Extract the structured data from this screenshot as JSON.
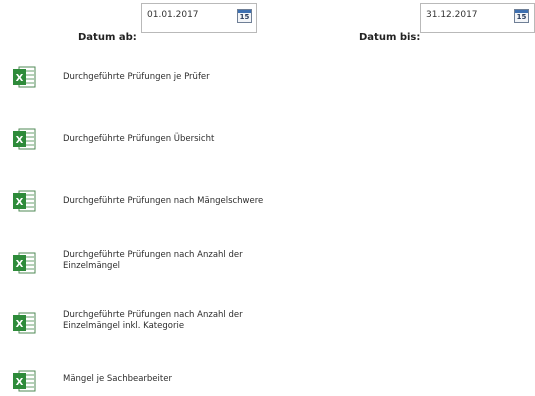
{
  "filters": {
    "date_from_label": "Datum ab:",
    "date_from_value": "01.01.2017",
    "date_to_label": "Datum bis:",
    "date_to_value": "31.12.2017",
    "calendar_day": "15"
  },
  "reports": [
    {
      "label": "Durchgeführte Prüfungen je Prüfer",
      "icon": "excel-icon"
    },
    {
      "label": "Durchgeführte Prüfungen Übersicht",
      "icon": "excel-icon"
    },
    {
      "label": "Durchgeführte Prüfungen nach Mängelschwere",
      "icon": "excel-icon"
    },
    {
      "label": "Durchgeführte Prüfungen nach Anzahl der Einzelmängel",
      "icon": "excel-icon"
    },
    {
      "label": "Durchgeführte Prüfungen nach Anzahl der Einzelmängel inkl. Kategorie",
      "icon": "excel-icon"
    },
    {
      "label": "Mängel je Sachbearbeiter",
      "icon": "excel-icon"
    }
  ],
  "colors": {
    "excel_green": "#2e8b3a",
    "calendar_blue": "#3d6fb0"
  }
}
